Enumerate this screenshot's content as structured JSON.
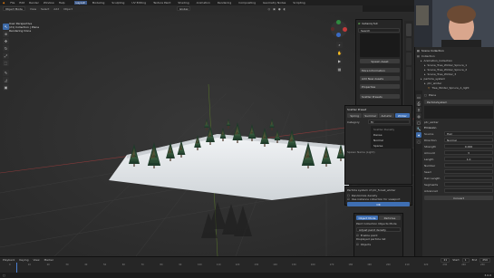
{
  "menubar": {
    "items": [
      "File",
      "Edit",
      "Render",
      "Window",
      "Help"
    ],
    "workspaces": [
      "Layout",
      "Modeling",
      "Sculpting",
      "UV Editing",
      "Texture Paint",
      "Shading",
      "Animation",
      "Rendering",
      "Compositing",
      "Geometry Nodes",
      "Scripting"
    ],
    "active_workspace": "Layout",
    "scene": "Scene",
    "view_layer": "ViewLayer"
  },
  "viewport_header": {
    "mode": "Object Mode",
    "menus": [
      "View",
      "Select",
      "Add",
      "Object"
    ],
    "orientation": "Global"
  },
  "overlay_text": {
    "line1": "User Perspective",
    "line2": "(21) Collection | Plane",
    "line3": "Rendering Done"
  },
  "npanel": {
    "addon_name": "botaniq full",
    "search_label": "Search",
    "spawn_label": "Spawn Asset",
    "more_info": "More Information",
    "add_new_assets": "Add New Assets",
    "properties": "Properties",
    "scatter_label": "Scatter Presets",
    "paint_label": "Paint",
    "mode": "Place"
  },
  "popup": {
    "title": "Scatter Preset",
    "tabs": [
      "Spring",
      "Summer",
      "Autumn",
      "Winter"
    ],
    "active_tab": "Winter",
    "options": [
      "Scatter Density",
      "Dense",
      "Normal",
      "Sparse"
    ],
    "category_label": "Category",
    "category_value": "Fir",
    "name_label": "Spawn Name (Light)",
    "description": "Particle system of ptc_forest_winter",
    "checkbox1": "Randomize density",
    "checkbox2": "Use instance collection for viewport",
    "ok_label": "OK"
  },
  "bottom_panel": {
    "tabs": [
      "Object Mode",
      "Particles"
    ],
    "header": "Paint Collection Objects Mode",
    "paint_mode": "Adjust paint density",
    "enable_paint": "Enable paint",
    "list": "Displayed particle list",
    "object": "Objects"
  },
  "outliner": {
    "title": "Scene Collection",
    "items": [
      {
        "label": "Collection",
        "indent": 0
      },
      {
        "label": "Animation_Collection",
        "indent": 1
      },
      {
        "label": "Scene_Tree_Winter_Spruce_1",
        "indent": 2
      },
      {
        "label": "Scene_Tree_Winter_Spruce_2",
        "indent": 2
      },
      {
        "label": "Scene_Tree_Winter_3",
        "indent": 2
      },
      {
        "label": "particle_system",
        "indent": 1
      },
      {
        "label": "ptc_winter",
        "indent": 2
      },
      {
        "label": "Tree_Winter_Spruce_A_light",
        "indent": 3
      },
      {
        "label": "Tree_Conifer_A_light(particles)",
        "indent": 3
      }
    ]
  },
  "properties": {
    "object": "Plane",
    "system_label": "ParticleSystem",
    "emission_label": "Emission",
    "source_label": "Source",
    "type_label": "Hair",
    "direction": "Normal",
    "strength": "0.000",
    "amount": "3",
    "length": "1.0",
    "settings": "ptc_winter",
    "fields": [
      "Number",
      "Seed",
      "Hair Length",
      "Segments",
      "Advanced"
    ],
    "convert_label": "Convert"
  },
  "timeline": {
    "menus": [
      "Playback",
      "Keying",
      "View",
      "Marker"
    ],
    "ticks": [
      "0",
      "10",
      "20",
      "30",
      "40",
      "50",
      "60",
      "70",
      "80",
      "90",
      "100",
      "110",
      "120",
      "130",
      "140",
      "150",
      "160",
      "170",
      "180",
      "190",
      "200",
      "210",
      "220",
      "230",
      "240",
      "250"
    ],
    "current_frame": "21",
    "start_label": "Start",
    "start": "1",
    "end_label": "End",
    "end": "250"
  },
  "statusbar": {
    "version": "3.0.0"
  },
  "colors": {
    "accent": "#3f6fb3",
    "panel": "#2b2b2b",
    "bg": "#1d1d1d",
    "snow": "#e9ecef"
  }
}
